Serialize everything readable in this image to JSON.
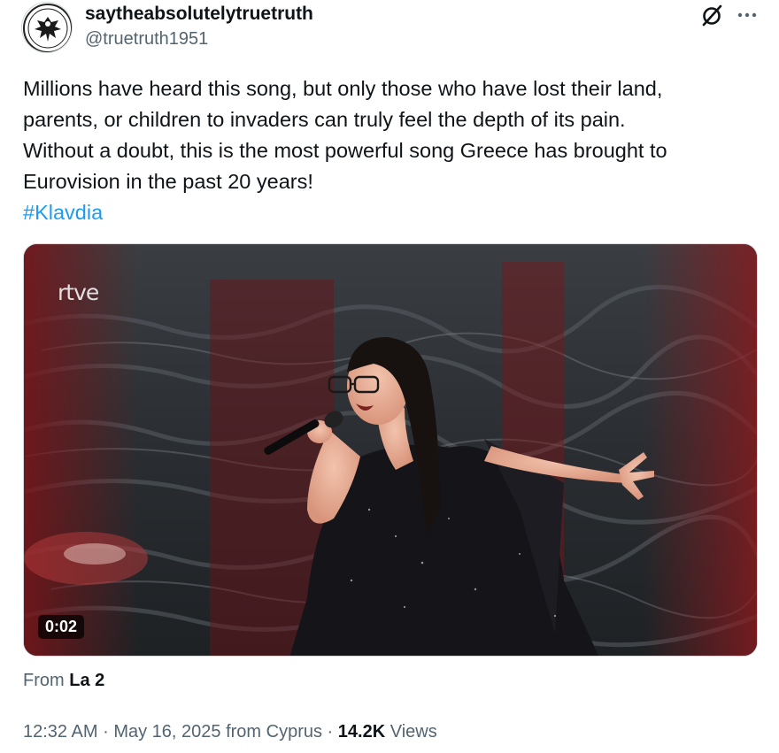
{
  "author": {
    "display_name": "saytheabsolutelytruetruth",
    "handle": "@truetruth1951",
    "avatar_icon": "paok-eagle-crest-icon",
    "avatar_text": "ΠΑΟΚ"
  },
  "header_actions": {
    "grok_icon": "grok-slash-circle-icon",
    "more_icon": "more-dots-icon"
  },
  "tweet": {
    "lines": [
      "Millions have heard this song, but only those who have lost their land,",
      "parents, or children to invaders can truly feel the depth of its pain.",
      "Without a doubt, this is the most powerful song Greece has brought to",
      "Eurovision in the past 20 years!"
    ],
    "hashtag": "#Klavdia",
    "hashtag_color": "#1d9bf0"
  },
  "media": {
    "watermark": "rtve",
    "duration": "0:02"
  },
  "source": {
    "prefix": "From",
    "name": "La 2"
  },
  "meta": {
    "time": "12:32 AM",
    "separator": "·",
    "date": "May 16, 2025",
    "location": "from Cyprus",
    "views_count": "14.2K",
    "views_label": "Views"
  },
  "colors": {
    "text": "#0f1419",
    "secondary": "#536471",
    "accent": "#1d9bf0"
  }
}
